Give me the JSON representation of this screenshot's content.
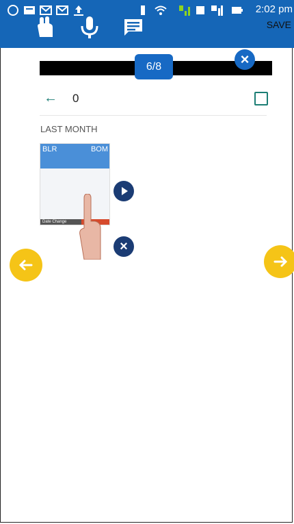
{
  "status_bar": {
    "time": "2:02 pm",
    "save_label": "SAVE"
  },
  "overlay": {
    "counter": "6/8"
  },
  "header": {
    "count": "0"
  },
  "section": {
    "title": "LAST MONTH"
  },
  "thumbnail": {
    "from_code": "BLR",
    "to_code": "BOM",
    "footer_left": "Date Change"
  },
  "colors": {
    "status_bar": "#1566b7",
    "accent_blue": "#1769c4",
    "nav_yellow": "#f5c417",
    "teal": "#1b7d74"
  },
  "icons": [
    "whatsapp-icon",
    "message-icon",
    "gmail-icon",
    "upload-icon",
    "vibrate-icon",
    "wifi-icon",
    "signal-icon",
    "battery-icon",
    "hand-icon",
    "mic-icon",
    "chat-icon",
    "close-icon",
    "back-arrow-icon",
    "checkbox-icon",
    "play-icon",
    "arrow-left-icon",
    "arrow-right-icon"
  ]
}
